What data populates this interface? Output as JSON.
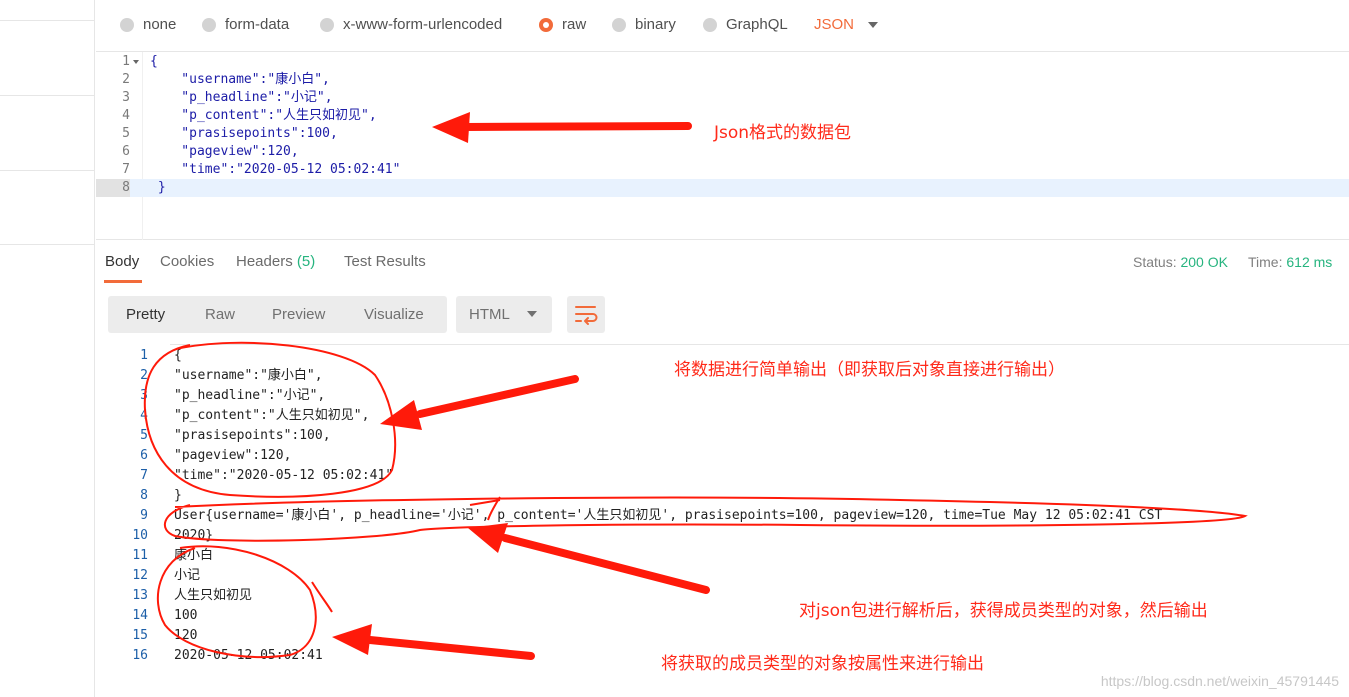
{
  "request": {
    "body_types": [
      {
        "label": "none",
        "selected": false
      },
      {
        "label": "form-data",
        "selected": false
      },
      {
        "label": "x-www-form-urlencoded",
        "selected": false
      },
      {
        "label": "raw",
        "selected": true
      },
      {
        "label": "binary",
        "selected": false
      },
      {
        "label": "GraphQL",
        "selected": false
      }
    ],
    "raw_format": "JSON",
    "lines": [
      {
        "n": "1",
        "text": "{"
      },
      {
        "n": "2",
        "text": "    \"username\":\"康小白\","
      },
      {
        "n": "3",
        "text": "    \"p_headline\":\"小记\","
      },
      {
        "n": "4",
        "text": "    \"p_content\":\"人生只如初见\","
      },
      {
        "n": "5",
        "text": "    \"prasisepoints\":100,"
      },
      {
        "n": "6",
        "text": "    \"pageview\":120,"
      },
      {
        "n": "7",
        "text": "    \"time\":\"2020-05-12 05:02:41\""
      },
      {
        "n": "8",
        "text": " }"
      }
    ]
  },
  "response": {
    "tabs": {
      "body": "Body",
      "cookies": "Cookies",
      "headers": "Headers",
      "headers_count": "(5)",
      "tests": "Test Results"
    },
    "status_label": "Status:",
    "status_value": "200 OK",
    "time_label": "Time:",
    "time_value": "612 ms",
    "views": {
      "pretty": "Pretty",
      "raw": "Raw",
      "preview": "Preview",
      "visualize": "Visualize"
    },
    "format": "HTML",
    "lines": [
      {
        "n": "1",
        "text": "{"
      },
      {
        "n": "2",
        "text": "\"username\":\"康小白\","
      },
      {
        "n": "3",
        "text": "\"p_headline\":\"小记\","
      },
      {
        "n": "4",
        "text": "\"p_content\":\"人生只如初见\","
      },
      {
        "n": "5",
        "text": "\"prasisepoints\":100,"
      },
      {
        "n": "6",
        "text": "\"pageview\":120,"
      },
      {
        "n": "7",
        "text": "\"time\":\"2020-05-12 05:02:41\""
      },
      {
        "n": "8",
        "text": "}"
      },
      {
        "n": "9",
        "text": "User{username='康小白', p_headline='小记', p_content='人生只如初见', prasisepoints=100, pageview=120, time=Tue May 12 05:02:41 CST"
      },
      {
        "n": "10",
        "text": "2020}"
      },
      {
        "n": "11",
        "text": "康小白"
      },
      {
        "n": "12",
        "text": "小记"
      },
      {
        "n": "13",
        "text": "人生只如初见"
      },
      {
        "n": "14",
        "text": "100"
      },
      {
        "n": "15",
        "text": "120"
      },
      {
        "n": "16",
        "text": "2020-05-12 05:02:41"
      }
    ]
  },
  "annotations": {
    "json_packet": "Json格式的数据包",
    "simple_output": "将数据进行简单输出（即获取后对象直接进行输出）",
    "parse_output": "对json包进行解析后，获得成员类型的对象，然后输出",
    "attr_output": "将获取的成员类型的对象按属性来进行输出"
  },
  "watermark": "https://blog.csdn.net/weixin_45791445",
  "colors": {
    "accent": "#f26b3a",
    "success": "#26b47f",
    "annotation": "#ff2a1a"
  }
}
